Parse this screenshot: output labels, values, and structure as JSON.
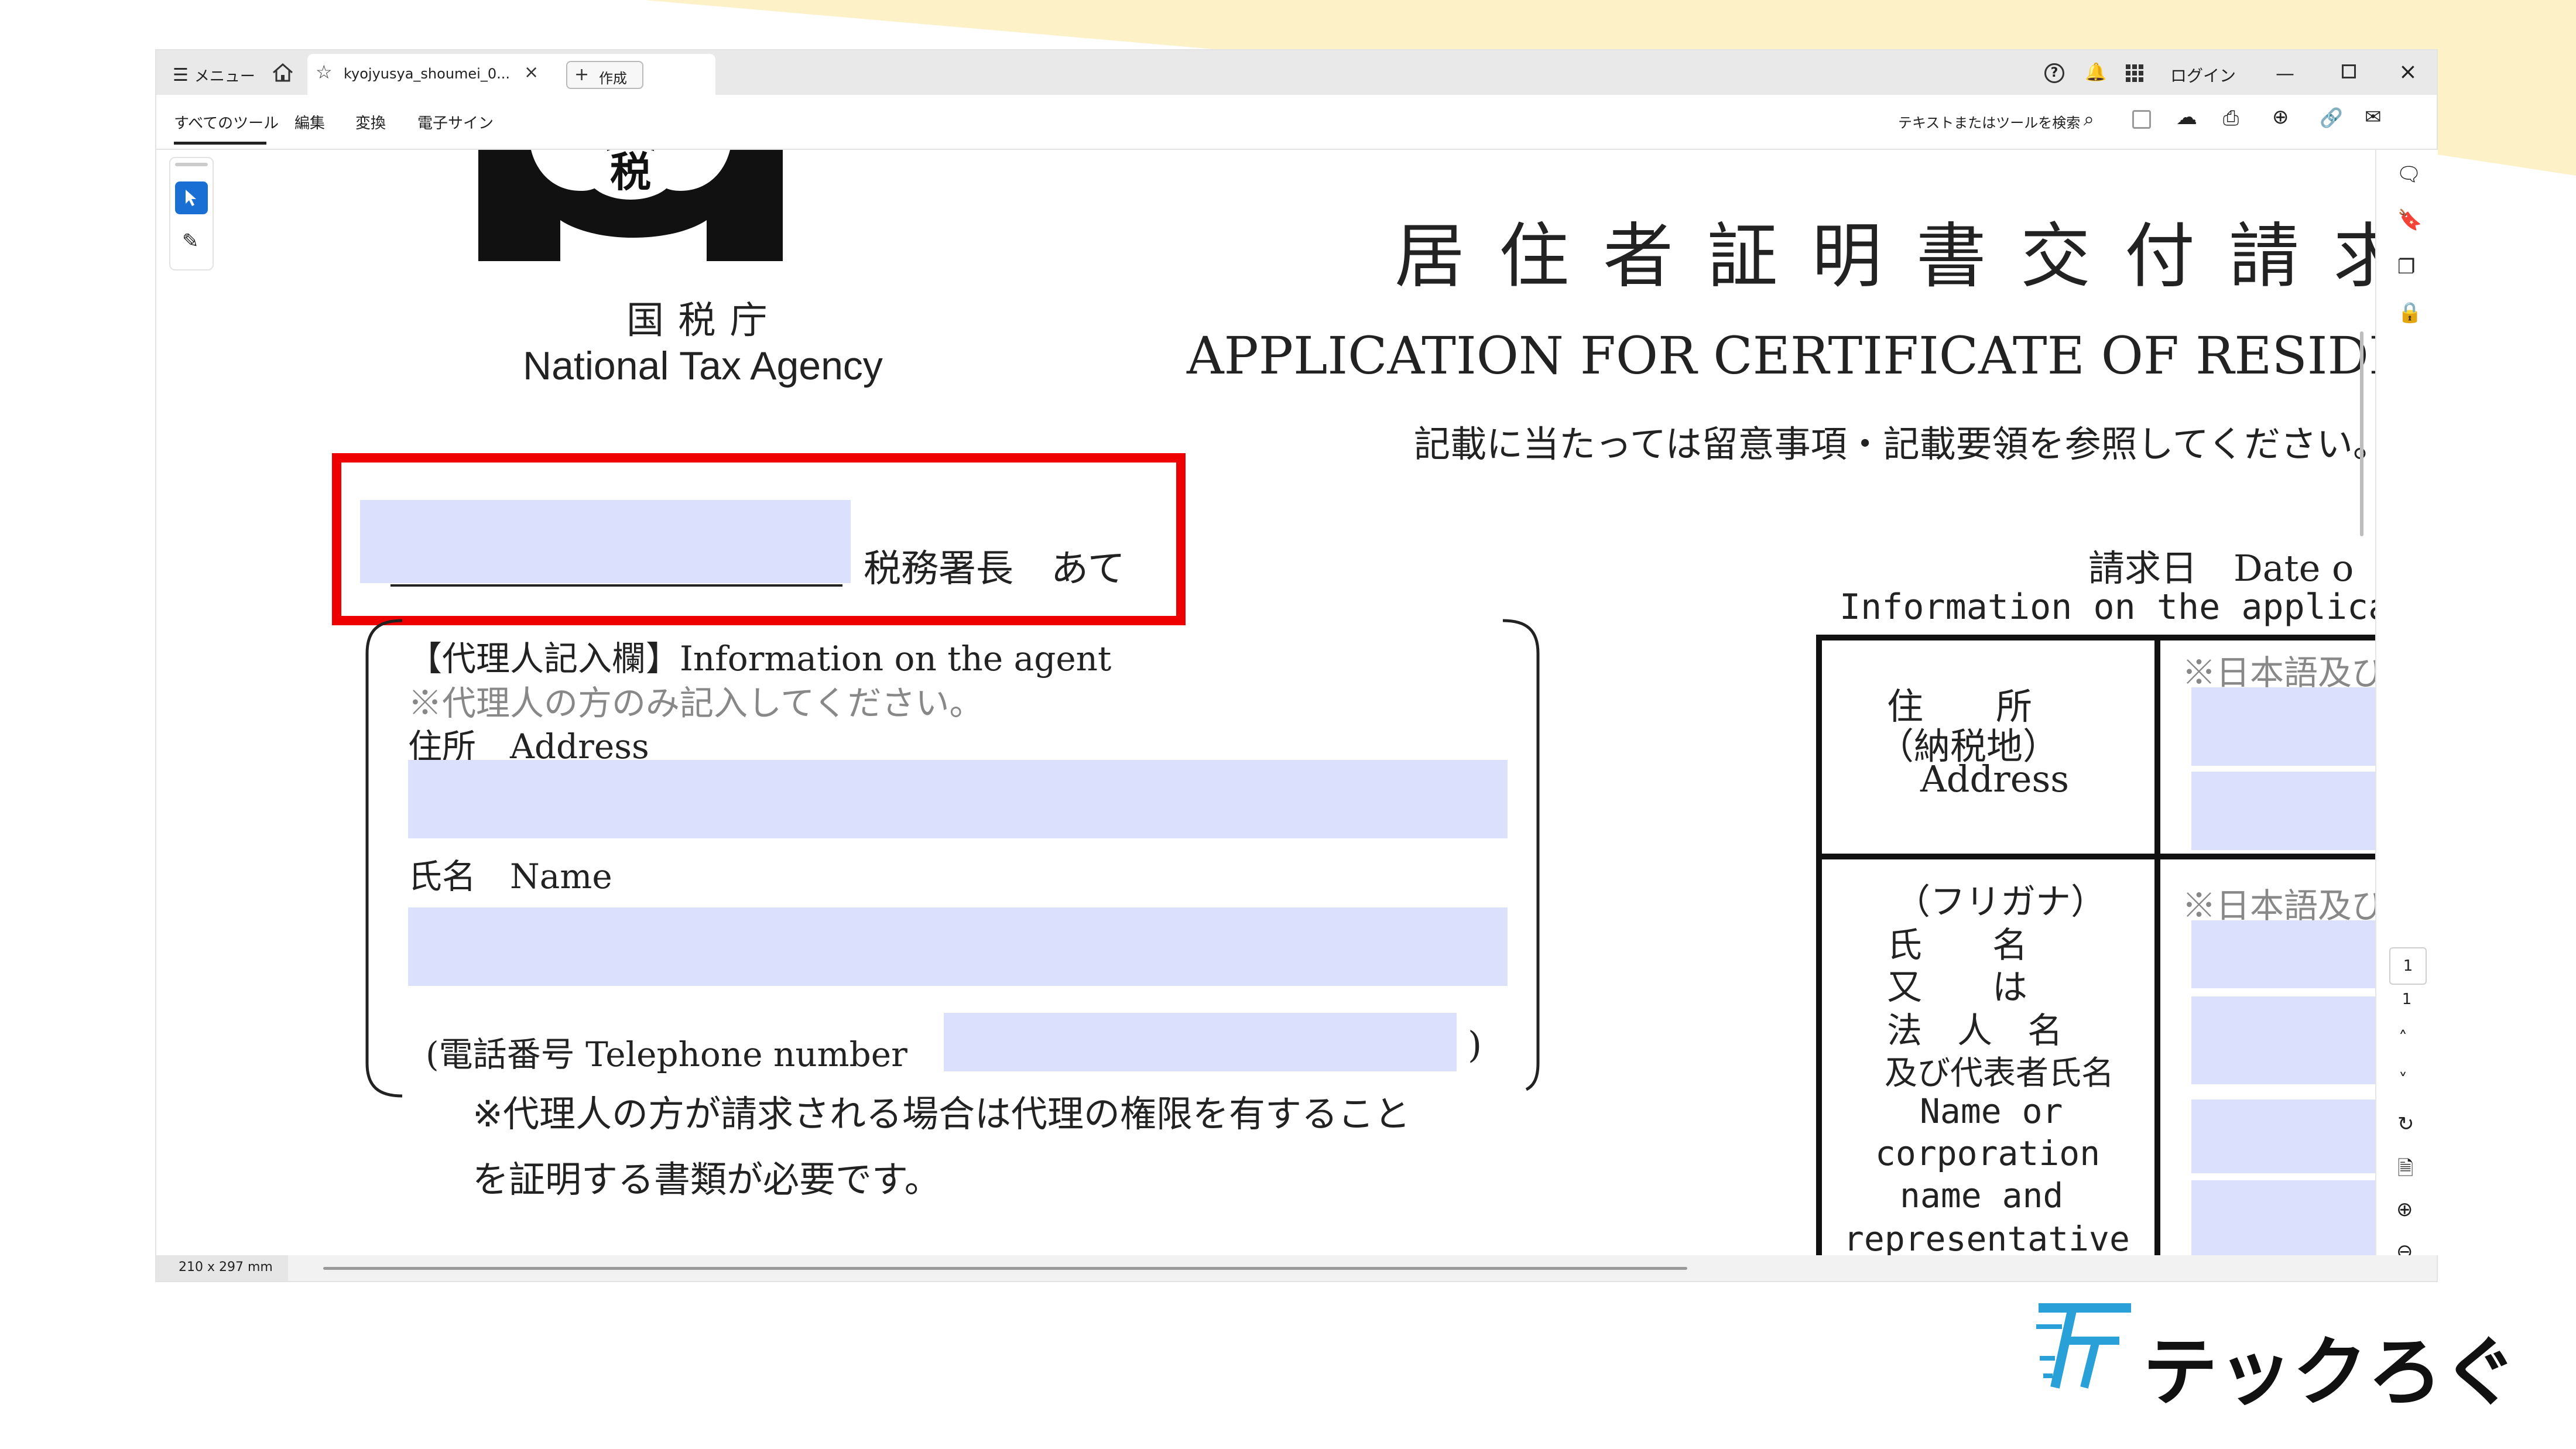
{
  "app": {
    "menu_label": "メニュー",
    "tab_title": "kyojyusya_shoumei_0...",
    "create_label": "作成",
    "login_label": "ログイン"
  },
  "toolbar": {
    "tabs": [
      "すべてのツール",
      "編集",
      "変換",
      "電子サイン"
    ],
    "search_label": "テキストまたはツールを検索"
  },
  "page_nav": {
    "current_page": "1",
    "total_pages": "1"
  },
  "status": {
    "page_size": "210 x 297 mm"
  },
  "document": {
    "agency_ja": "国 税 庁",
    "agency_en": "National Tax Agency",
    "logo_char": "税",
    "title_ja": "居 住 者 証 明 書 交 付 請 求 書",
    "title_en": "APPLICATION FOR CERTIFICATE OF RESIDENCE I",
    "note": "記載に当たっては留意事項・記載要領を参照してください。",
    "tax_office_suffix": "税務署長　あて",
    "request_date": "請求日　Date o",
    "applicant_header": "Information on the applicant:",
    "agent_section": {
      "title": "【代理人記入欄】Information on the agent",
      "note": "※代理人の方のみ記入してください。",
      "address_label": "住所　Address",
      "name_label": "氏名　Name",
      "phone_label": "(電話番号 Telephone number",
      "phone_close": ")",
      "footnote_line1": "※代理人の方が請求される場合は代理の権限を有すること",
      "footnote_line2": "を証明する書類が必要です。"
    },
    "applicant_table": {
      "address_label_1": "住　　所",
      "address_label_2": "（納税地）",
      "address_label_3": "Address",
      "lang_note": "※日本語及び英語で",
      "name_labels": [
        "（フリガナ）",
        "氏　　名",
        "又　　は",
        "法　人　名",
        "及び代表者氏名",
        "Name or",
        "corporation",
        "name and",
        "representative"
      ]
    }
  },
  "brand": {
    "name": "テックろぐ"
  }
}
